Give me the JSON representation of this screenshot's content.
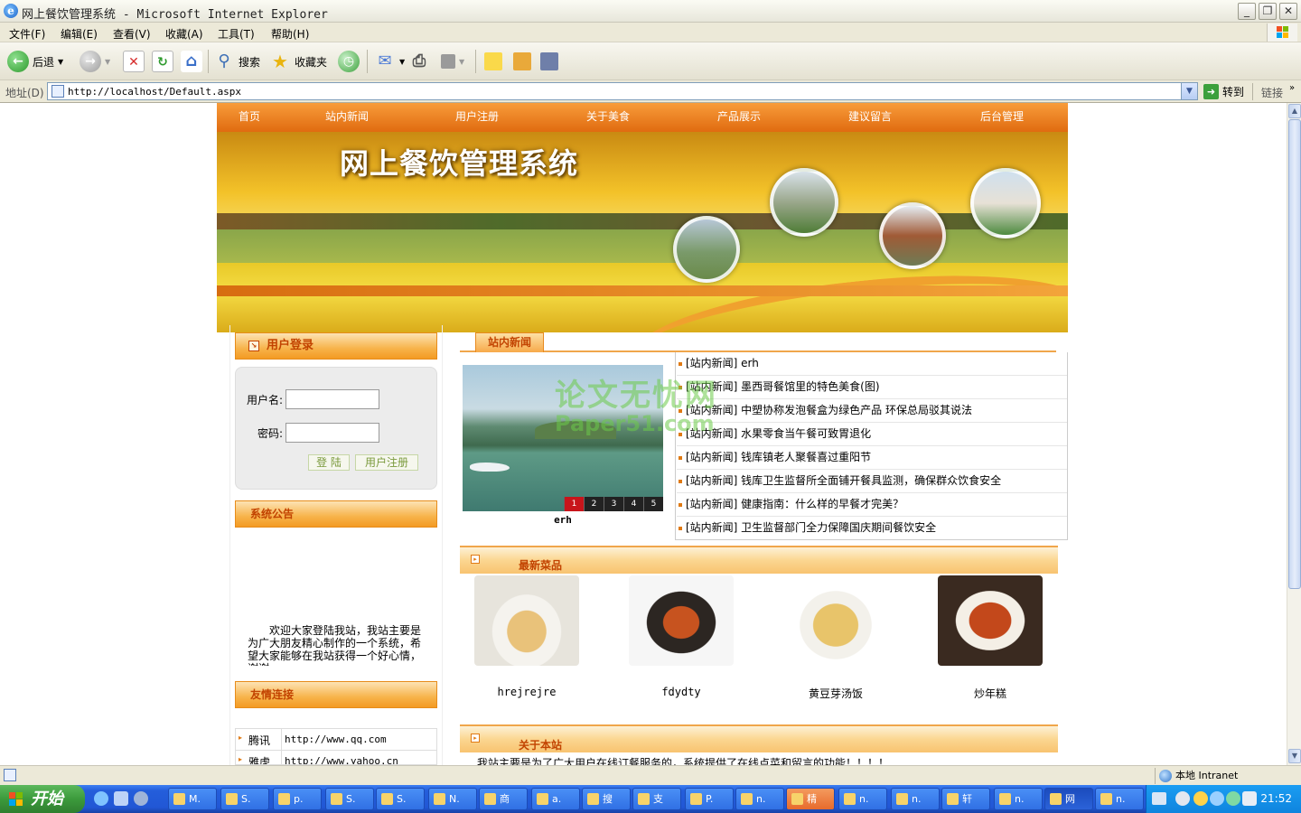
{
  "window": {
    "title": "网上餐饮管理系统 - Microsoft Internet Explorer"
  },
  "menubar": {
    "items": [
      "文件(F)",
      "编辑(E)",
      "查看(V)",
      "收藏(A)",
      "工具(T)",
      "帮助(H)"
    ]
  },
  "toolbar": {
    "back": "后退",
    "search": "搜索",
    "favorites": "收藏夹"
  },
  "address": {
    "label": "地址(D)",
    "url": "http://localhost/Default.aspx",
    "go": "转到",
    "links": "链接"
  },
  "site": {
    "title": "网上餐饮管理系统",
    "nav": [
      "首页",
      "站内新闻",
      "用户注册",
      "关于美食",
      "产品展示",
      "建议留言",
      "后台管理"
    ],
    "login": {
      "heading": "用户登录",
      "username_label": "用户名:",
      "password_label": "密码:",
      "login_btn": "登 陆",
      "register_btn": "用户注册"
    },
    "notice": {
      "heading": "系统公告",
      "text": "欢迎大家登陆我站，我站主要是为广大朋友精心制作的一个系统，希望大家能够在我站获得一个好心情，谢谢"
    },
    "links": {
      "heading": "友情连接",
      "items": [
        {
          "name": "腾讯",
          "url": "http://www.qq.com"
        },
        {
          "name": "雅虎",
          "url": "http://www.yahoo.cn"
        }
      ]
    },
    "news": {
      "tab": "站内新闻",
      "caption": "erh",
      "slides": [
        "1",
        "2",
        "3",
        "4",
        "5"
      ],
      "items": [
        "[站内新闻] erh",
        "[站内新闻] 墨西哥餐馆里的特色美食(图)",
        "[站内新闻] 中塑协称发泡餐盒为绿色产品 环保总局驳其说法",
        "[站内新闻] 水果零食当午餐可致胃退化",
        "[站内新闻] 钱库镇老人聚餐喜过重阳节",
        "[站内新闻] 钱库卫生监督所全面铺开餐具监测，确保群众饮食安全",
        "[站内新闻] 健康指南：什么样的早餐才完美？",
        "[站内新闻] 卫生监督部门全力保障国庆期间餐饮安全"
      ]
    },
    "dishes": {
      "heading": "最新菜品",
      "items": [
        "hrejrejre",
        "fdydty",
        "黄豆芽汤饭",
        "炒年糕"
      ]
    },
    "about": {
      "heading": "关于本站",
      "text": "我站主要是为了广大用户在线订餐服务的，系统提供了在线点菜和留言的功能！！！！"
    },
    "watermark": {
      "line1": "论文无忧网",
      "line2": "Paper51.com"
    }
  },
  "statusbar": {
    "zone": "本地 Intranet"
  },
  "taskbar": {
    "start": "开始",
    "buttons": [
      "M.",
      "S.",
      "p.",
      "S.",
      "S.",
      "N.",
      "商",
      "a.",
      "搜",
      "支",
      "P.",
      "n.",
      "精",
      "n.",
      "n.",
      "轩",
      "n.",
      "网",
      "n."
    ],
    "clock": "21:52"
  }
}
